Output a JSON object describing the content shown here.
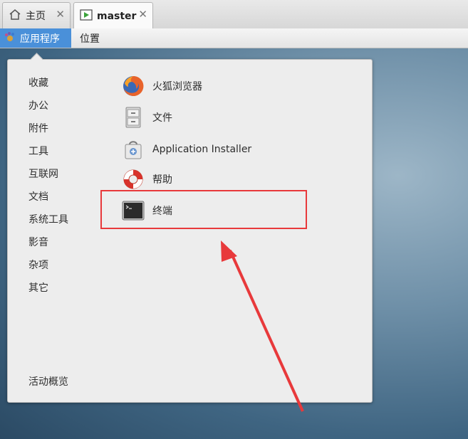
{
  "tabs": [
    {
      "label": "主页",
      "icon": "home-icon",
      "close": "✕"
    },
    {
      "label": "master",
      "icon": "vm-play-icon",
      "close": "✕"
    }
  ],
  "panel": {
    "applications_label": "应用程序",
    "places_label": "位置"
  },
  "menu": {
    "categories": [
      "收藏",
      "办公",
      "附件",
      "工具",
      "互联网",
      "文档",
      "系统工具",
      "影音",
      "杂项",
      "其它"
    ],
    "activities_label": "活动概览",
    "apps": [
      {
        "label": "火狐浏览器",
        "icon": "firefox-icon"
      },
      {
        "label": "文件",
        "icon": "file-cabinet-icon"
      },
      {
        "label": "Application Installer",
        "icon": "software-bag-icon"
      },
      {
        "label": "帮助",
        "icon": "lifebuoy-icon"
      },
      {
        "label": "终端",
        "icon": "terminal-icon"
      }
    ]
  },
  "colors": {
    "accent": "#4a90d9",
    "annotation": "#e8393b"
  }
}
